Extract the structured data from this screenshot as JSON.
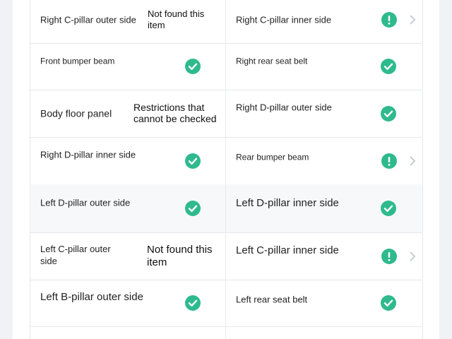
{
  "colors": {
    "status_green": "#2fba8d",
    "chevron_gray": "#c8ccd2"
  },
  "rows": [
    {
      "left": {
        "label": "Right C-pillar outer side",
        "status": "Not found this item",
        "icon": "none"
      },
      "right": {
        "label": "Right C-pillar inner side",
        "status": "",
        "icon": "warning-icon",
        "chevron": true
      }
    },
    {
      "left": {
        "label": "Front bumper beam",
        "status": "",
        "icon": "check-icon"
      },
      "right": {
        "label": "Right rear seat belt",
        "status": "",
        "icon": "check-icon"
      }
    },
    {
      "left": {
        "label": "Body floor panel",
        "status": "Restrictions that cannot be checked",
        "icon": "none"
      },
      "right": {
        "label": "Right D-pillar outer side",
        "status": "",
        "icon": "check-icon"
      }
    },
    {
      "left": {
        "label": "Right D-pillar inner side",
        "status": "",
        "icon": "check-icon"
      },
      "right": {
        "label": "Rear bumper beam",
        "status": "",
        "icon": "warning-icon",
        "chevron": true
      }
    },
    {
      "left": {
        "label": "Left D-pillar outer side",
        "status": "",
        "icon": "check-icon"
      },
      "right": {
        "label": "Left D-pillar inner side",
        "status": "",
        "icon": "check-icon"
      }
    },
    {
      "left": {
        "label": "Left C-pillar outer side",
        "status": "Not found this item",
        "icon": "none"
      },
      "right": {
        "label": "Left C-pillar inner side",
        "status": "",
        "icon": "warning-icon",
        "chevron": true
      }
    },
    {
      "left": {
        "label": "Left B-pillar outer side",
        "status": "",
        "icon": "check-icon"
      },
      "right": {
        "label": "Left rear seat belt",
        "status": "",
        "icon": "check-icon"
      }
    },
    {
      "left": {
        "label": "",
        "status": "",
        "icon": "none"
      },
      "right": {
        "label": "",
        "status": "",
        "icon": "none"
      }
    }
  ]
}
